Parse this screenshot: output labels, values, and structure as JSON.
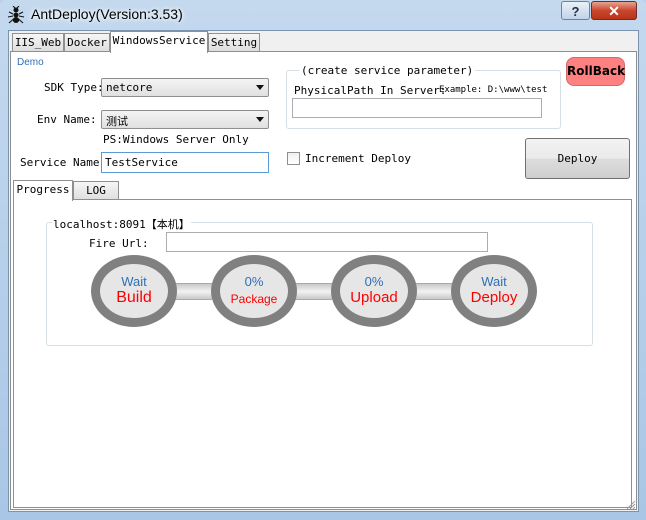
{
  "window": {
    "title": "AntDeploy(Version:3.53)",
    "help_label": "?",
    "close_label": "✕"
  },
  "tabs": [
    "IIS_Web",
    "Docker",
    "WindowsService",
    "Setting"
  ],
  "form": {
    "demo_label": "Demo",
    "sdk_type_label": "SDK Type:",
    "sdk_type_value": "netcore",
    "env_name_label": "Env Name:",
    "env_name_value": "测试",
    "env_hint": "PS:Windows Server Only",
    "service_name_label": "Service Name:",
    "service_name_value": "TestService",
    "param_group_title": "(create service parameter)",
    "physical_path_label": "PhysicalPath In Server:",
    "physical_path_example": "Example: D:\\www\\test",
    "physical_path_value": "",
    "increment_label": "Increment Deploy",
    "rollback_label": "RollBack",
    "deploy_label": "Deploy"
  },
  "inner_tabs": [
    "Progress",
    "LOG"
  ],
  "progress": {
    "server_title": "localhost:8091【本机】",
    "fire_url_label": "Fire Url:",
    "fire_url_value": "",
    "steps": [
      {
        "status": "Wait",
        "name": "Build"
      },
      {
        "status": "0%",
        "name": "Package"
      },
      {
        "status": "0%",
        "name": "Upload"
      },
      {
        "status": "Wait",
        "name": "Deploy"
      }
    ]
  },
  "colors": {
    "rollback": "#ff8080",
    "step_name": "#ff0000",
    "step_status": "#2f6fb5",
    "ring": "#808080"
  }
}
